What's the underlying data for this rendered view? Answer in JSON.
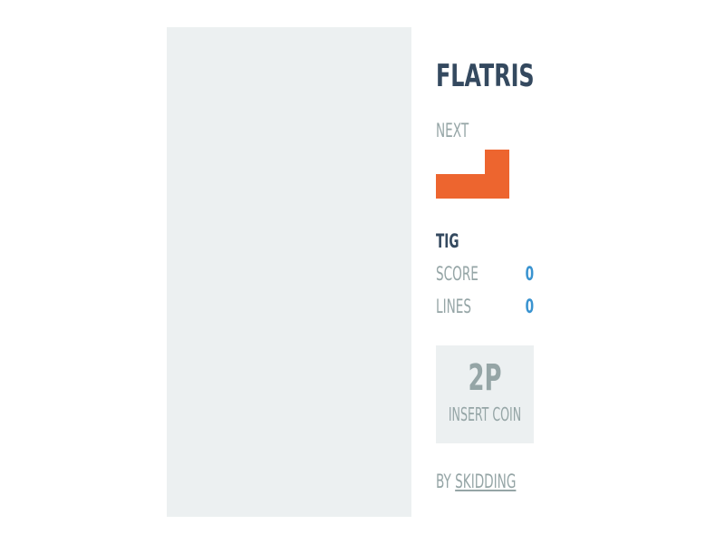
{
  "game": {
    "title": "FLATRIS",
    "next_label": "NEXT",
    "next_piece": {
      "name": "L",
      "color": "#ed652f",
      "grid": [
        [
          0,
          0,
          1
        ],
        [
          1,
          1,
          1
        ]
      ]
    },
    "player": {
      "name": "TIG",
      "score_label": "SCORE",
      "score": "0",
      "lines_label": "LINES",
      "lines": "0"
    },
    "insert_coin": {
      "title": "2P",
      "subtitle": "INSERT COIN"
    },
    "credit": {
      "prefix": "BY ",
      "author": "SKIDDING"
    }
  },
  "colors": {
    "well_background": "#ecf0f1",
    "title": "#34495f",
    "label": "#95a5a6",
    "value": "#3993d0",
    "piece": "#ed652f"
  }
}
